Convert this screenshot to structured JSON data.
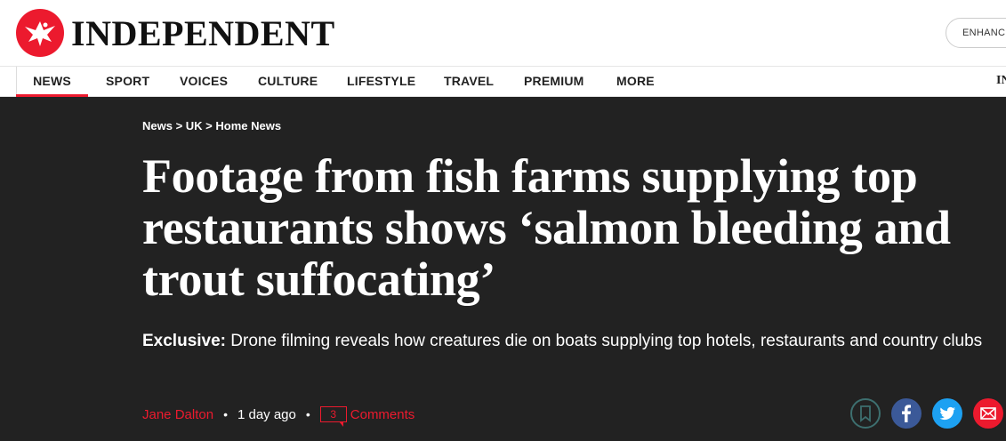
{
  "header": {
    "brand": "INDEPENDENT",
    "enhance_label": "ENHANCE"
  },
  "nav": {
    "items": [
      {
        "label": "NEWS",
        "active": true
      },
      {
        "label": "SPORT"
      },
      {
        "label": "VOICES"
      },
      {
        "label": "CULTURE"
      },
      {
        "label": "LIFESTYLE"
      },
      {
        "label": "TRAVEL"
      },
      {
        "label": "PREMIUM"
      },
      {
        "label": "MORE"
      }
    ],
    "right_partial": "IN"
  },
  "article": {
    "breadcrumb": "News > UK > Home News",
    "headline": "Footage from fish farms supplying top restaurants shows ‘salmon bleeding and trout suffocating’",
    "standfirst_lead": "Exclusive:",
    "standfirst_rest": " Drone filming reveals how creatures die on boats supplying top hotels, restaurants and country clubs",
    "author": "Jane Dalton",
    "separator": "•",
    "time": "1 day ago",
    "comment_count": "3",
    "comments_label": "Comments"
  },
  "icons": {
    "logo": "eagle-logo-icon",
    "bookmark": "bookmark-icon",
    "facebook": "facebook-icon",
    "twitter": "twitter-icon",
    "email": "email-icon"
  },
  "colors": {
    "brand_red": "#ec1a2e",
    "hero_bg": "#222222",
    "facebook": "#3b5998",
    "twitter": "#1da1f2"
  }
}
